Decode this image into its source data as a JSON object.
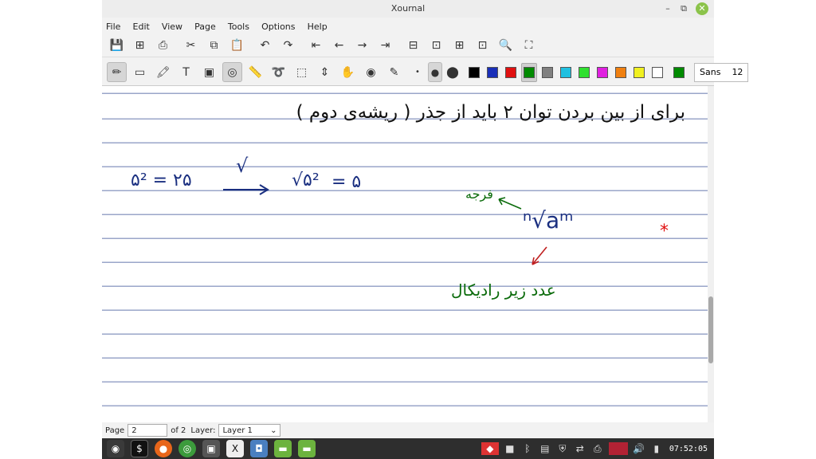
{
  "window": {
    "title": "Xournal",
    "minimize": "–",
    "maximize": "⧉",
    "close": "✕"
  },
  "menu": [
    "File",
    "Edit",
    "View",
    "Page",
    "Tools",
    "Options",
    "Help"
  ],
  "toolbar1": [
    {
      "name": "save-icon",
      "glyph": "💾"
    },
    {
      "name": "new-page-icon",
      "glyph": "⊞"
    },
    {
      "name": "print-icon",
      "glyph": "⎙"
    },
    {
      "name": "cut-icon",
      "glyph": "✂"
    },
    {
      "name": "copy-icon",
      "glyph": "⧉"
    },
    {
      "name": "paste-icon",
      "glyph": "📋"
    },
    {
      "name": "undo-icon",
      "glyph": "↶"
    },
    {
      "name": "redo-icon",
      "glyph": "↷"
    },
    {
      "name": "first-page-icon",
      "glyph": "⇤"
    },
    {
      "name": "prev-page-icon",
      "glyph": "←"
    },
    {
      "name": "next-page-icon",
      "glyph": "→"
    },
    {
      "name": "last-page-icon",
      "glyph": "⇥"
    },
    {
      "name": "zoom-out-icon",
      "glyph": "⊟"
    },
    {
      "name": "zoom-fit-icon",
      "glyph": "⊡"
    },
    {
      "name": "zoom-in-icon",
      "glyph": "⊞"
    },
    {
      "name": "zoom-normal-icon",
      "glyph": "⊡"
    },
    {
      "name": "find-icon",
      "glyph": "🔍"
    },
    {
      "name": "fullscreen-icon",
      "glyph": "⛶"
    }
  ],
  "toolbar2": [
    {
      "name": "pen-icon",
      "glyph": "✏",
      "active": true
    },
    {
      "name": "eraser-icon",
      "glyph": "▭"
    },
    {
      "name": "highlighter-icon",
      "glyph": "🖍"
    },
    {
      "name": "text-icon",
      "glyph": "T"
    },
    {
      "name": "image-icon",
      "glyph": "▣"
    },
    {
      "name": "shape-recognizer-icon",
      "glyph": "◎",
      "active": true
    },
    {
      "name": "ruler-icon",
      "glyph": "📏"
    },
    {
      "name": "lasso-icon",
      "glyph": "➰"
    },
    {
      "name": "rect-select-icon",
      "glyph": "⬚"
    },
    {
      "name": "vertical-space-icon",
      "glyph": "⇕"
    },
    {
      "name": "hand-icon",
      "glyph": "✋"
    },
    {
      "name": "default-pen-icon",
      "glyph": "◉"
    },
    {
      "name": "pen-settings-icon",
      "glyph": "✎"
    }
  ],
  "thickness": [
    {
      "name": "thickness-fine-icon",
      "glyph": "•"
    },
    {
      "name": "thickness-medium-icon",
      "glyph": "●",
      "active": true
    },
    {
      "name": "thickness-thick-icon",
      "glyph": "⬤"
    }
  ],
  "colors": [
    {
      "name": "color-black",
      "hex": "#000000"
    },
    {
      "name": "color-blue",
      "hex": "#1a2fb8"
    },
    {
      "name": "color-red",
      "hex": "#e01010"
    },
    {
      "name": "color-green",
      "hex": "#008a00",
      "active": true
    },
    {
      "name": "color-gray",
      "hex": "#808080"
    },
    {
      "name": "color-lightblue",
      "hex": "#20c0e0"
    },
    {
      "name": "color-lightgreen",
      "hex": "#30e030"
    },
    {
      "name": "color-magenta",
      "hex": "#e020e0"
    },
    {
      "name": "color-orange",
      "hex": "#f08010"
    },
    {
      "name": "color-yellow",
      "hex": "#f0f020"
    },
    {
      "name": "color-white",
      "hex": "#ffffff"
    },
    {
      "name": "color-current",
      "hex": "#008a00"
    }
  ],
  "font": {
    "name": "Sans",
    "size": "12"
  },
  "notes": {
    "line1": "برای از بین بردن توان ۲ باید از جذر ( ریشه‌ی دوم )",
    "eq_left": "۵² = ۲۵",
    "arrow_label": "√",
    "eq_right_rad": "√۵²",
    "eq_right_val": "= ۵",
    "radical": "ⁿ√aᵐ",
    "label_index": "فرجه",
    "label_radicand": "عدد زیر رادیکال",
    "star": "*"
  },
  "status": {
    "page_label": "Page",
    "page_value": "2",
    "of_label": "of 2",
    "layer_label": "Layer:",
    "layer_value": "Layer 1"
  },
  "taskbar": {
    "clock": "07:52:05"
  }
}
